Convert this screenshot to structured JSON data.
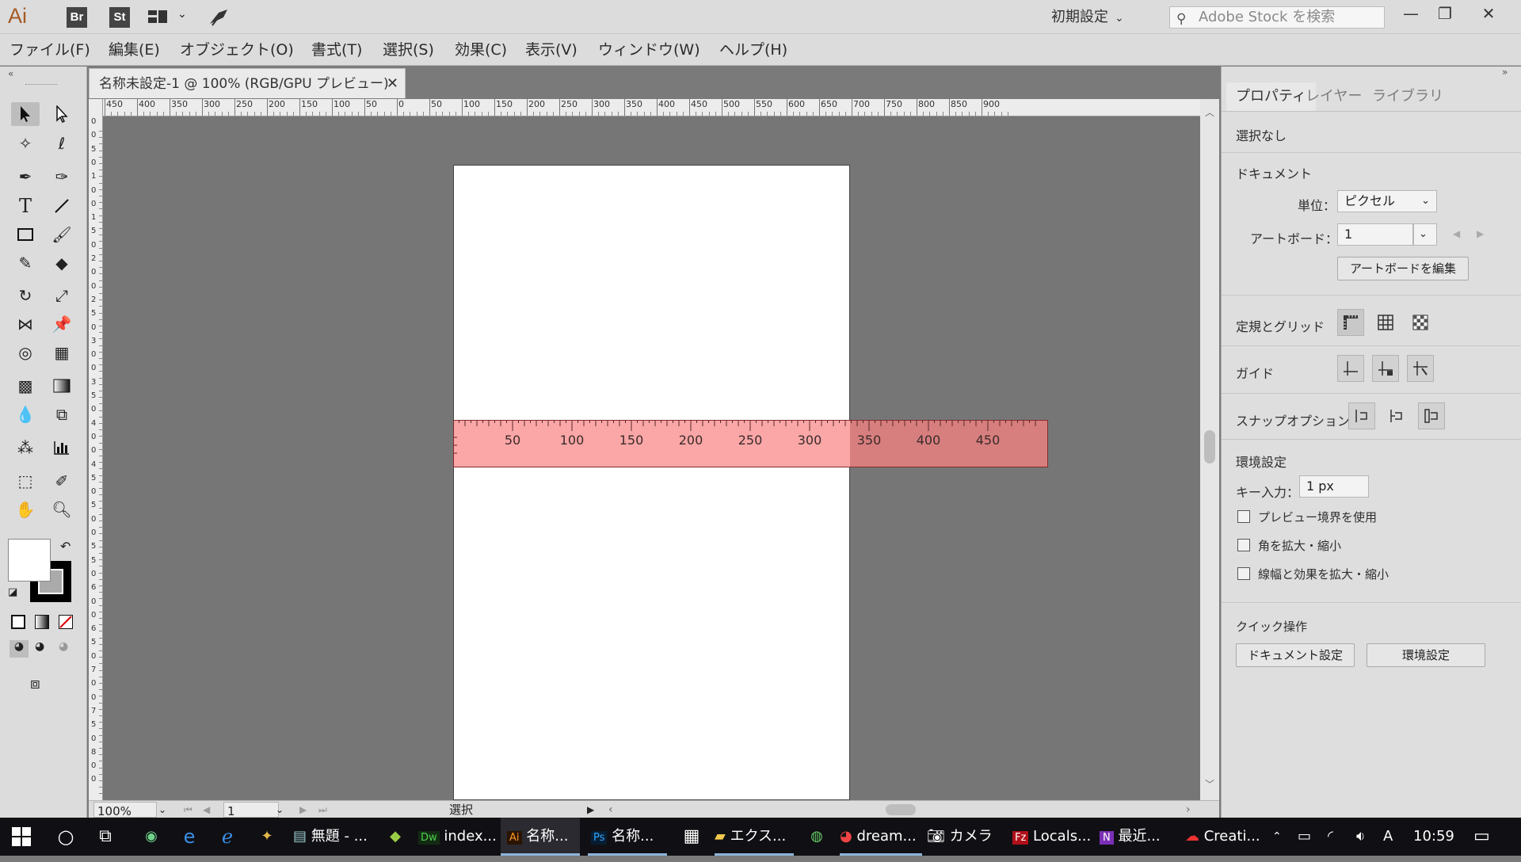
{
  "app": {
    "logo": "Ai",
    "bridge": "Br",
    "stock": "St",
    "workspace": "初期設定",
    "search_placeholder": "Adobe Stock を検索"
  },
  "menu": [
    "ファイル(F)",
    "編集(E)",
    "オブジェクト(O)",
    "書式(T)",
    "選択(S)",
    "効果(C)",
    "表示(V)",
    "ウィンドウ(W)",
    "ヘルプ(H)"
  ],
  "document": {
    "tab_title": "名称未設定-1 @ 100% (RGB/GPU プレビュー)"
  },
  "hruler_labels": [
    "450",
    "400",
    "350",
    "300",
    "250",
    "200",
    "150",
    "100",
    "50",
    "0",
    "50",
    "100",
    "150",
    "200",
    "250",
    "300",
    "350",
    "400",
    "450",
    "500",
    "550",
    "600",
    "650",
    "700",
    "750",
    "800",
    "850",
    "900"
  ],
  "vruler_labels": [
    "0",
    "0",
    "5",
    "0",
    "1",
    "0",
    "0",
    "1",
    "5",
    "0",
    "2",
    "0",
    "0",
    "2",
    "5",
    "0",
    "3",
    "0",
    "0",
    "3",
    "5",
    "0",
    "4",
    "0",
    "0",
    "4",
    "5",
    "0",
    "5",
    "0",
    "0",
    "5",
    "5",
    "0",
    "6",
    "0",
    "0",
    "6",
    "5",
    "0",
    "7",
    "0",
    "0",
    "7",
    "5",
    "0",
    "8",
    "0",
    "0"
  ],
  "overlay_ruler": {
    "labels": [
      "50",
      "100",
      "150",
      "200",
      "250",
      "300",
      "350",
      "400",
      "450"
    ]
  },
  "statusbar": {
    "zoom": "100%",
    "artboard": "1",
    "mode": "選択"
  },
  "properties": {
    "tabs": [
      "プロパティ",
      "レイヤー",
      "ライブラリ"
    ],
    "selection": "選択なし",
    "document_header": "ドキュメント",
    "unit_label": "単位：",
    "unit_value": "ピクセル",
    "artboard_label": "アートボード：",
    "artboard_value": "1",
    "edit_artboard": "アートボードを編集",
    "rulers_grid": "定規とグリッド",
    "guides": "ガイド",
    "snap_options": "スナップオプション",
    "preferences_header": "環境設定",
    "key_input_label": "キー入力：",
    "key_input_value": "1 px",
    "cb_preview_bounds": "プレビュー境界を使用",
    "cb_scale_corners": "角を拡大・縮小",
    "cb_scale_strokes": "線幅と効果を拡大・縮小",
    "quick_actions": "クイック操作",
    "btn_doc_setup": "ドキュメント設定",
    "btn_prefs": "環境設定"
  },
  "taskbar": {
    "items": [
      "無題 - ...",
      "index...",
      "名称...",
      "名称...",
      "エクス...",
      "dream...",
      "カメラ",
      "Locals...",
      "最近...",
      "Creati..."
    ],
    "clock": "10:59"
  },
  "colors": {
    "ruler_pink": "#fba7a7",
    "ruler_dark": "#d77e7e",
    "accent_ai": "#a65a25"
  }
}
